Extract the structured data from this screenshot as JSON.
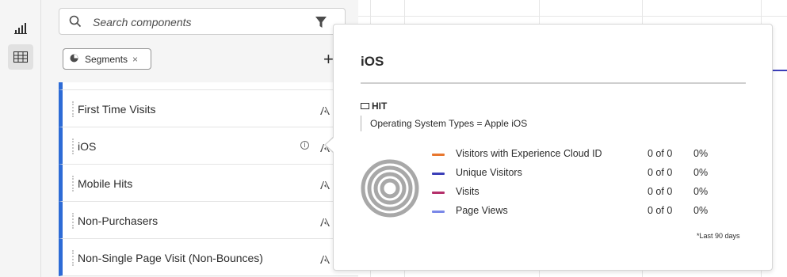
{
  "rail": {
    "items": [
      {
        "icon": "bar-chart-icon"
      },
      {
        "icon": "table-grid-icon"
      }
    ]
  },
  "panel": {
    "search_placeholder": "Search components",
    "tag_label": "Segments",
    "tag_remove": "×",
    "add_label": "+",
    "rows": [
      {
        "label": "First Time Visits"
      },
      {
        "label": "iOS",
        "info": "i"
      },
      {
        "label": "Mobile Hits"
      },
      {
        "label": "Non-Purchasers"
      },
      {
        "label": "Non-Single Page Visit (Non-Bounces)"
      }
    ]
  },
  "popover": {
    "title": "iOS",
    "container": "HIT",
    "rule": "Operating System Types = Apple iOS",
    "metrics": [
      {
        "label": "Visitors with Experience Cloud ID",
        "count": "0 of 0",
        "pct": "0%",
        "color": "#e8772e"
      },
      {
        "label": "Unique Visitors",
        "count": "0 of 0",
        "pct": "0%",
        "color": "#3b3fb8"
      },
      {
        "label": "Visits",
        "count": "0 of 0",
        "pct": "0%",
        "color": "#b5306b"
      },
      {
        "label": "Page Views",
        "count": "0 of 0",
        "pct": "0%",
        "color": "#7a88e8"
      }
    ],
    "footnote": "*Last 90 days"
  },
  "colors": {
    "segment_bar": "#2d6bd6",
    "donut_ring": "#a8a8a8"
  }
}
